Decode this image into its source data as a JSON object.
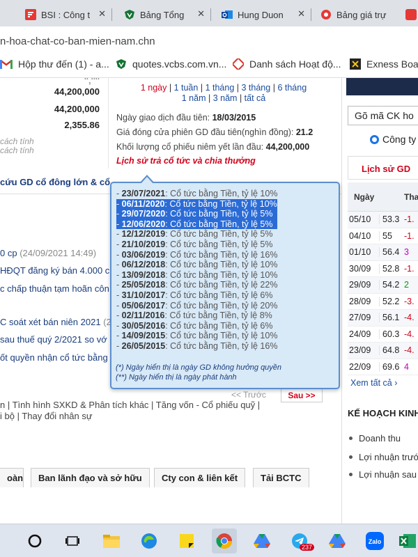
{
  "browser": {
    "tabs": [
      {
        "title": "BSI : Công t",
        "icon": "bsi-icon"
      },
      {
        "title": "Bảng Tổng",
        "icon": "vcb-shield-icon"
      },
      {
        "title": "Hung Duon",
        "icon": "outlook-icon"
      },
      {
        "title": "Bảng giá trự",
        "icon": "chrome-red-icon"
      },
      {
        "title": "",
        "icon": "red-icon"
      }
    ],
    "address": "n-hoa-chat-co-ban-mien-nam.chn",
    "bookmarks": [
      {
        "label": "Hộp thư đến (1) - a...",
        "icon": "gmail-icon"
      },
      {
        "label": "quotes.vcbs.com.vn...",
        "icon": "vcb-shield-icon"
      },
      {
        "label": "Danh sách Hoạt độ...",
        "icon": "hoat-dong-icon"
      },
      {
        "label": "Exness Board",
        "icon": "exness-icon"
      }
    ]
  },
  "left_numbers": [
    "44,200,000",
    "44,200,000",
    "2,355.86"
  ],
  "left_notes": [
    "cách tính",
    "cách tính"
  ],
  "periods": {
    "row1": [
      "1 ngày",
      "1 tuần",
      "1 tháng",
      "3 tháng",
      "6 tháng"
    ],
    "row2": [
      "1 năm",
      "3 năm",
      "tất cả"
    ],
    "sep": "|"
  },
  "info": [
    {
      "label": "Ngày giao dịch đầu tiên:",
      "value": "18/03/2015"
    },
    {
      "label": "Giá đóng cửa phiên GD đầu tiên(nghìn đồng):",
      "value": "21.2"
    },
    {
      "label": "Khối lượng cổ phiếu niêm yết lần đầu:",
      "value": "44,200,000"
    }
  ],
  "history_link": "Lịch sử trả cổ tức và chia thưởng",
  "section_title": "cứu GD cổ đông lớn & cổ",
  "news": [
    {
      "text": "0 cp",
      "date": "(24/09/2021 14:49)"
    },
    {
      "text": "HĐQT đăng ký bán 4.000 c",
      "date": ""
    },
    {
      "text": "c chấp thuận tạm hoãn côn",
      "date": ""
    },
    {
      "text": "C soát xét bán niên 2021",
      "date": "(2"
    },
    {
      "text": "sau thuế quý 2/2021 so vớ",
      "date": ""
    },
    {
      "text": "ốt quyền nhận cổ tức bằng",
      "date": ""
    }
  ],
  "pager": {
    "prev": "<< Trước",
    "next": "Sau >>"
  },
  "links_row1": "n | Tình hình SXKD & Phân tích khác | Tăng vốn - Cổ phiếu quỹ |",
  "links_row2": "i bộ | Thay đổi nhân sự",
  "bottom_tabs": [
    "oàn",
    "Ban lãnh đạo và sở hữu",
    "Cty con & liên kết",
    "Tải BCTC"
  ],
  "popup": {
    "dividends": [
      {
        "date": "23/07/2021",
        "text": "Cổ tức bằng Tiền, tỷ lệ 10%",
        "selected": false
      },
      {
        "date": "06/11/2020",
        "text": "Cổ tức bằng Tiền, tỷ lệ 10%",
        "selected": true
      },
      {
        "date": "29/07/2020",
        "text": "Cổ tức bằng Tiền, tỷ lệ 5%",
        "selected": true
      },
      {
        "date": "12/06/2020",
        "text": "Cổ tức bằng Tiền, tỷ lệ 5%",
        "selected": true
      },
      {
        "date": "12/12/2019",
        "text": "Cổ tức bằng Tiền, tỷ lệ 5%",
        "selected": false
      },
      {
        "date": "21/10/2019",
        "text": "Cổ tức bằng Tiền, tỷ lệ 5%",
        "selected": false
      },
      {
        "date": "03/06/2019",
        "text": "Cổ tức bằng Tiền, tỷ lệ 16%",
        "selected": false
      },
      {
        "date": "06/12/2018",
        "text": "Cổ tức bằng Tiền, tỷ lệ 10%",
        "selected": false
      },
      {
        "date": "13/09/2018",
        "text": "Cổ tức bằng Tiền, tỷ lệ 10%",
        "selected": false
      },
      {
        "date": "25/05/2018",
        "text": "Cổ tức bằng Tiền, tỷ lệ 22%",
        "selected": false
      },
      {
        "date": "31/10/2017",
        "text": "Cổ tức bằng Tiền, tỷ lệ 6%",
        "selected": false
      },
      {
        "date": "05/06/2017",
        "text": "Cổ tức bằng Tiền, tỷ lệ 20%",
        "selected": false
      },
      {
        "date": "02/11/2016",
        "text": "Cổ tức bằng Tiền, tỷ lệ 8%",
        "selected": false
      },
      {
        "date": "30/05/2016",
        "text": "Cổ tức bằng Tiền, tỷ lệ 6%",
        "selected": false
      },
      {
        "date": "14/09/2015",
        "text": "Cổ tức bằng Tiền, tỷ lệ 10%",
        "selected": false
      },
      {
        "date": "26/05/2015",
        "text": "Cổ tức bằng Tiền, tỷ lệ 16%",
        "selected": false
      }
    ],
    "note1": "(*) Ngày hiển thị là ngày GD không hưởng quyền",
    "note2": "(**) Ngày hiển thị là ngày phát hành"
  },
  "right_panel": {
    "search_placeholder": "Gõ mã CK ho",
    "radio_label": "Công ty",
    "tab_label": "Lịch sử GD",
    "headers": [
      "Ngày",
      "Tha"
    ],
    "rows": [
      {
        "date": "05/10",
        "price": "53.3",
        "chg": "-1.",
        "color": "#d0021b"
      },
      {
        "date": "04/10",
        "price": "55",
        "chg": "-1.",
        "color": "#d0021b"
      },
      {
        "date": "01/10",
        "price": "56.4",
        "chg": "3",
        "color": "#c000c0"
      },
      {
        "date": "30/09",
        "price": "52.8",
        "chg": "-1.",
        "color": "#d0021b"
      },
      {
        "date": "29/09",
        "price": "54.2",
        "chg": "2",
        "color": "#0a9a0a"
      },
      {
        "date": "28/09",
        "price": "52.2",
        "chg": "-3.",
        "color": "#d0021b"
      },
      {
        "date": "27/09",
        "price": "56.1",
        "chg": "-4.",
        "color": "#d0021b"
      },
      {
        "date": "24/09",
        "price": "60.3",
        "chg": "-4.",
        "color": "#d0021b"
      },
      {
        "date": "23/09",
        "price": "64.8",
        "chg": "-4.",
        "color": "#d0021b"
      },
      {
        "date": "22/09",
        "price": "69.6",
        "chg": "4",
        "color": "#c000c0"
      }
    ],
    "see_all": "Xem tất cả",
    "plan_title": "KẾ HOẠCH KINH",
    "plan_items": [
      "Doanh thu",
      "Lợi nhuận trước",
      "Lợi nhuận sau"
    ]
  },
  "taskbar": {
    "icons": [
      "search-icon",
      "task-view-icon",
      "file-explorer-icon",
      "edge-icon",
      "sticky-notes-icon",
      "chrome-icon",
      "drive-icon",
      "telegram-icon",
      "drive-icon-2",
      "zalo-icon",
      "excel-icon"
    ],
    "telegram_badge": "237",
    "zalo_label": "Zalo"
  }
}
